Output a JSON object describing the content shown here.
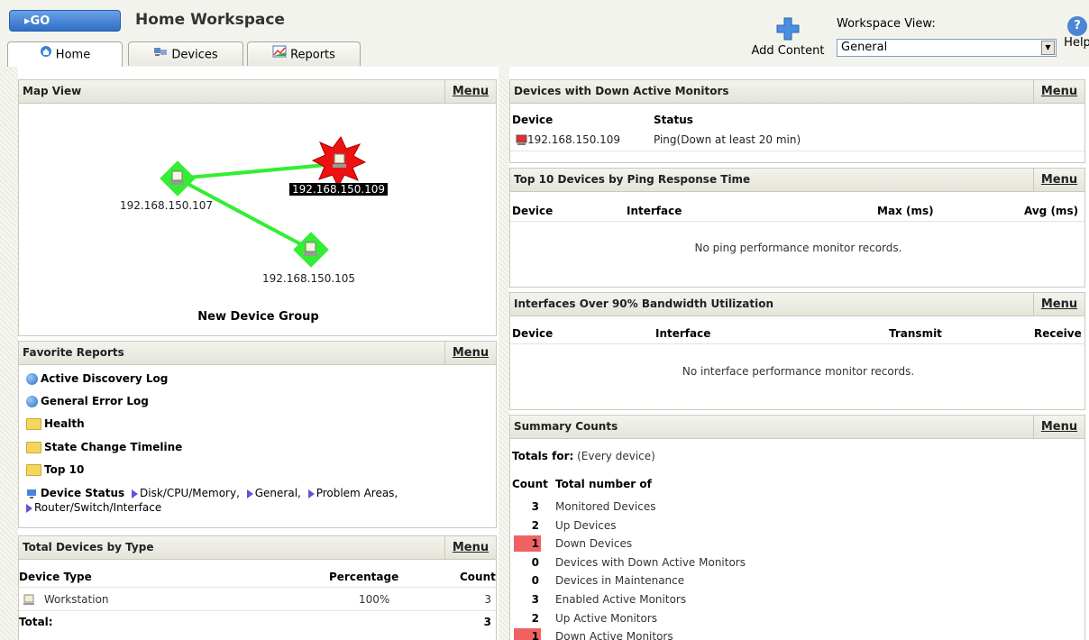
{
  "header": {
    "go_label": "▸GO",
    "title": "Home Workspace",
    "tabs": [
      {
        "label": "Home",
        "icon": "home-icon"
      },
      {
        "label": "Devices",
        "icon": "devices-icon"
      },
      {
        "label": "Reports",
        "icon": "reports-icon"
      }
    ],
    "add_content_label": "Add Content",
    "workspace_view_label": "Workspace View:",
    "workspace_view_value": "General",
    "help_label": "Help"
  },
  "map_view": {
    "title": "Map View",
    "menu": "Menu",
    "nodes": [
      {
        "ip": "192.168.150.107",
        "status": "up"
      },
      {
        "ip": "192.168.150.109",
        "status": "down"
      },
      {
        "ip": "192.168.150.105",
        "status": "up"
      }
    ],
    "group_name": "New Device Group"
  },
  "favorite_reports": {
    "title": "Favorite Reports",
    "menu": "Menu",
    "items": [
      {
        "label": "Active Discovery Log",
        "icon": "globe-icon"
      },
      {
        "label": "General Error Log",
        "icon": "globe-icon"
      },
      {
        "label": "Health",
        "icon": "folder-icon"
      },
      {
        "label": "State Change Timeline",
        "icon": "folder-icon"
      },
      {
        "label": "Top 10",
        "icon": "folder-icon"
      }
    ],
    "device_status": {
      "label": "Device Status",
      "links": [
        "Disk/CPU/Memory,",
        "General,",
        "Problem Areas,",
        "Router/Switch/Interface"
      ]
    }
  },
  "total_devices": {
    "title": "Total Devices by Type",
    "menu": "Menu",
    "columns": [
      "Device Type",
      "Percentage",
      "Count"
    ],
    "rows": [
      {
        "type": "Workstation",
        "percentage": "100%",
        "count": "3"
      }
    ],
    "total_label": "Total:",
    "total_count": "3"
  },
  "down_monitors": {
    "title": "Devices with Down Active Monitors",
    "menu": "Menu",
    "columns": [
      "Device",
      "Status"
    ],
    "rows": [
      {
        "device": "192.168.150.109",
        "status": "Ping(Down at least 20 min)"
      }
    ]
  },
  "top10_ping": {
    "title": "Top 10 Devices by Ping Response Time",
    "menu": "Menu",
    "columns": [
      "Device",
      "Interface",
      "Max (ms)",
      "Avg (ms)"
    ],
    "empty": "No ping performance monitor records."
  },
  "bandwidth": {
    "title": "Interfaces Over 90% Bandwidth Utilization",
    "menu": "Menu",
    "columns": [
      "Device",
      "Interface",
      "Transmit",
      "Receive"
    ],
    "empty": "No interface performance monitor records."
  },
  "summary": {
    "title": "Summary Counts",
    "menu": "Menu",
    "totals_for_label": "Totals for:",
    "totals_for_value": "(Every device)",
    "col_count": "Count",
    "col_total": "Total number of",
    "rows": [
      {
        "count": "3",
        "label": "Monitored Devices",
        "alert": false
      },
      {
        "count": "2",
        "label": "Up Devices",
        "alert": false
      },
      {
        "count": "1",
        "label": "Down Devices",
        "alert": true
      },
      {
        "count": "0",
        "label": "Devices with Down Active Monitors",
        "alert": false
      },
      {
        "count": "0",
        "label": "Devices in Maintenance",
        "alert": false
      },
      {
        "count": "3",
        "label": "Enabled Active Monitors",
        "alert": false
      },
      {
        "count": "2",
        "label": "Up Active Monitors",
        "alert": false
      },
      {
        "count": "1",
        "label": "Down Active Monitors",
        "alert": true
      }
    ]
  },
  "colors": {
    "accent": "#2f6fc9",
    "up": "#22dd22",
    "down": "#ee1111",
    "alert": "#f06262"
  }
}
